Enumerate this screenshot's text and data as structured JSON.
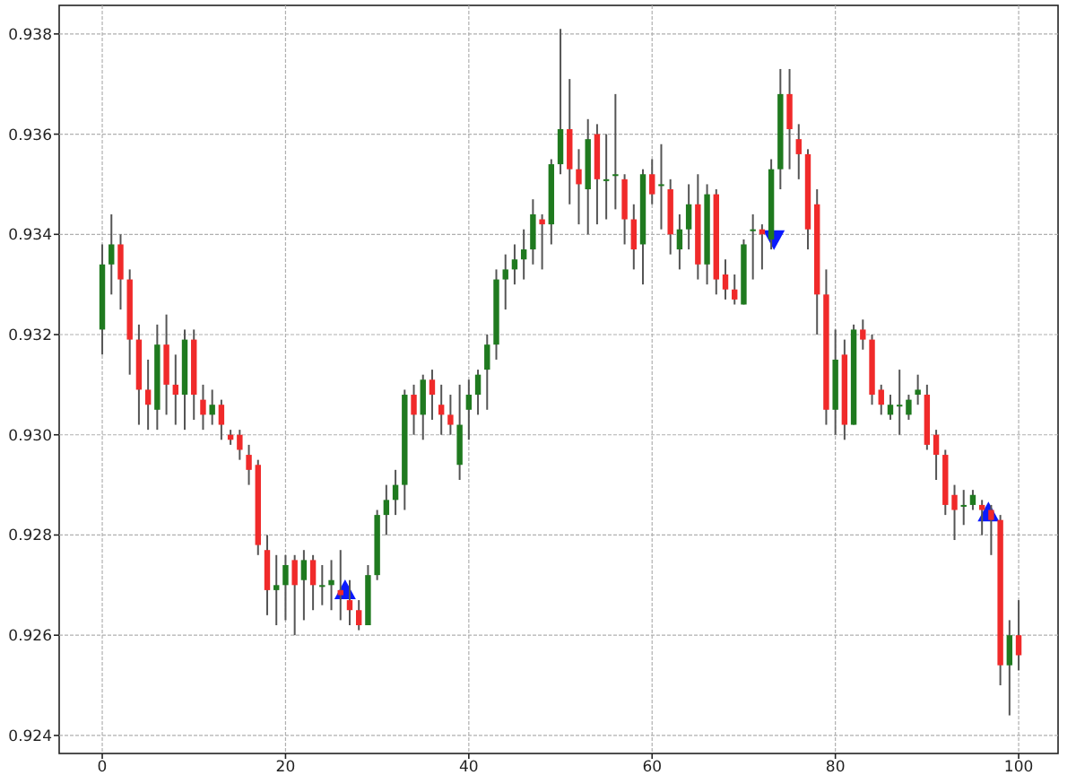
{
  "chart_data": {
    "type": "candlestick",
    "grid": true,
    "x": [
      0,
      1,
      2,
      3,
      4,
      5,
      6,
      7,
      8,
      9,
      10,
      11,
      12,
      13,
      14,
      15,
      16,
      17,
      18,
      19,
      20,
      21,
      22,
      23,
      24,
      25,
      26,
      27,
      28,
      29,
      30,
      31,
      32,
      33,
      34,
      35,
      36,
      37,
      38,
      39,
      40,
      41,
      42,
      43,
      44,
      45,
      46,
      47,
      48,
      49,
      50,
      51,
      52,
      53,
      54,
      55,
      56,
      57,
      58,
      59,
      60,
      61,
      62,
      63,
      64,
      65,
      66,
      67,
      68,
      69,
      70,
      71,
      72,
      73,
      74,
      75,
      76,
      77,
      78,
      79,
      80,
      81,
      82,
      83,
      84,
      85,
      86,
      87,
      88,
      89,
      90,
      91,
      92,
      93,
      94,
      95,
      96,
      97,
      98,
      99,
      100
    ],
    "ohlc": [
      [
        0.9321,
        0.9338,
        0.9316,
        0.9334
      ],
      [
        0.9334,
        0.9344,
        0.9328,
        0.9338
      ],
      [
        0.9338,
        0.934,
        0.9325,
        0.9331
      ],
      [
        0.9331,
        0.9333,
        0.9312,
        0.9319
      ],
      [
        0.9319,
        0.9322,
        0.9302,
        0.9309
      ],
      [
        0.9309,
        0.9315,
        0.9301,
        0.9306
      ],
      [
        0.9305,
        0.9322,
        0.9301,
        0.9318
      ],
      [
        0.9318,
        0.9324,
        0.9304,
        0.931
      ],
      [
        0.931,
        0.9316,
        0.9302,
        0.9308
      ],
      [
        0.9308,
        0.9321,
        0.9301,
        0.9319
      ],
      [
        0.9319,
        0.9321,
        0.9303,
        0.9308
      ],
      [
        0.9307,
        0.931,
        0.9301,
        0.9304
      ],
      [
        0.9304,
        0.9309,
        0.9302,
        0.9306
      ],
      [
        0.9306,
        0.9307,
        0.9299,
        0.9302
      ],
      [
        0.93,
        0.9301,
        0.9298,
        0.9299
      ],
      [
        0.93,
        0.9301,
        0.9295,
        0.9297
      ],
      [
        0.9296,
        0.9298,
        0.929,
        0.9293
      ],
      [
        0.9294,
        0.9295,
        0.9276,
        0.9278
      ],
      [
        0.9277,
        0.928,
        0.9264,
        0.9269
      ],
      [
        0.9269,
        0.9276,
        0.9262,
        0.927
      ],
      [
        0.927,
        0.9276,
        0.9263,
        0.9274
      ],
      [
        0.9275,
        0.9276,
        0.926,
        0.927
      ],
      [
        0.9271,
        0.9277,
        0.9263,
        0.9275
      ],
      [
        0.9275,
        0.9276,
        0.9265,
        0.927
      ],
      [
        0.927,
        0.9274,
        0.9266,
        0.927
      ],
      [
        0.927,
        0.9275,
        0.9265,
        0.9271
      ],
      [
        0.9269,
        0.9277,
        0.9263,
        0.9268
      ],
      [
        0.9267,
        0.9271,
        0.9262,
        0.9265
      ],
      [
        0.9265,
        0.9267,
        0.9261,
        0.9262
      ],
      [
        0.9262,
        0.9274,
        0.9262,
        0.9272
      ],
      [
        0.9272,
        0.9285,
        0.9271,
        0.9284
      ],
      [
        0.9284,
        0.929,
        0.928,
        0.9287
      ],
      [
        0.9287,
        0.9293,
        0.9284,
        0.929
      ],
      [
        0.929,
        0.9309,
        0.9285,
        0.9308
      ],
      [
        0.9308,
        0.931,
        0.93,
        0.9304
      ],
      [
        0.9304,
        0.9312,
        0.9299,
        0.9311
      ],
      [
        0.9311,
        0.9313,
        0.9303,
        0.9308
      ],
      [
        0.9306,
        0.931,
        0.93,
        0.9304
      ],
      [
        0.9304,
        0.9308,
        0.93,
        0.9302
      ],
      [
        0.9294,
        0.931,
        0.9291,
        0.9302
      ],
      [
        0.9305,
        0.9311,
        0.9299,
        0.9308
      ],
      [
        0.9308,
        0.9313,
        0.9304,
        0.9312
      ],
      [
        0.9313,
        0.932,
        0.9305,
        0.9318
      ],
      [
        0.9318,
        0.9333,
        0.9315,
        0.9331
      ],
      [
        0.9331,
        0.9336,
        0.9325,
        0.9333
      ],
      [
        0.9333,
        0.9338,
        0.933,
        0.9335
      ],
      [
        0.9335,
        0.9341,
        0.9331,
        0.9337
      ],
      [
        0.9337,
        0.9347,
        0.9334,
        0.9344
      ],
      [
        0.9343,
        0.9344,
        0.9333,
        0.9342
      ],
      [
        0.9342,
        0.9355,
        0.9338,
        0.9354
      ],
      [
        0.9354,
        0.9381,
        0.9352,
        0.9361
      ],
      [
        0.9361,
        0.9371,
        0.9346,
        0.9353
      ],
      [
        0.9353,
        0.9357,
        0.9342,
        0.935
      ],
      [
        0.9349,
        0.9363,
        0.934,
        0.9359
      ],
      [
        0.936,
        0.9362,
        0.9342,
        0.9351
      ],
      [
        0.9351,
        0.936,
        0.9343,
        0.9351
      ],
      [
        0.9352,
        0.9368,
        0.9345,
        0.9352
      ],
      [
        0.9351,
        0.9352,
        0.9338,
        0.9343
      ],
      [
        0.9343,
        0.9346,
        0.9333,
        0.9337
      ],
      [
        0.9338,
        0.9353,
        0.933,
        0.9352
      ],
      [
        0.9352,
        0.9355,
        0.9346,
        0.9348
      ],
      [
        0.935,
        0.9358,
        0.9341,
        0.935
      ],
      [
        0.9349,
        0.9351,
        0.9336,
        0.934
      ],
      [
        0.9337,
        0.9344,
        0.9333,
        0.9341
      ],
      [
        0.9341,
        0.935,
        0.9337,
        0.9346
      ],
      [
        0.9346,
        0.9352,
        0.9331,
        0.9334
      ],
      [
        0.9334,
        0.935,
        0.933,
        0.9348
      ],
      [
        0.9348,
        0.9349,
        0.9328,
        0.9331
      ],
      [
        0.9332,
        0.9335,
        0.9327,
        0.9329
      ],
      [
        0.9329,
        0.9332,
        0.9326,
        0.9327
      ],
      [
        0.9326,
        0.9339,
        0.9326,
        0.9338
      ],
      [
        0.9341,
        0.9344,
        0.9331,
        0.9341
      ],
      [
        0.9341,
        0.9342,
        0.9333,
        0.934
      ],
      [
        0.9339,
        0.9355,
        0.9337,
        0.9353
      ],
      [
        0.9353,
        0.9373,
        0.9349,
        0.9368
      ],
      [
        0.9368,
        0.9373,
        0.9353,
        0.9361
      ],
      [
        0.9359,
        0.9362,
        0.9351,
        0.9356
      ],
      [
        0.9356,
        0.9357,
        0.9337,
        0.9341
      ],
      [
        0.9346,
        0.9349,
        0.932,
        0.9328
      ],
      [
        0.9328,
        0.9333,
        0.9302,
        0.9305
      ],
      [
        0.9305,
        0.9321,
        0.93,
        0.9315
      ],
      [
        0.9316,
        0.9319,
        0.9299,
        0.9302
      ],
      [
        0.9302,
        0.9322,
        0.9302,
        0.9321
      ],
      [
        0.9321,
        0.9323,
        0.9317,
        0.9319
      ],
      [
        0.9319,
        0.932,
        0.9306,
        0.9308
      ],
      [
        0.9309,
        0.931,
        0.9304,
        0.9306
      ],
      [
        0.9304,
        0.9308,
        0.9303,
        0.9306
      ],
      [
        0.9306,
        0.9313,
        0.93,
        0.9306
      ],
      [
        0.9304,
        0.9308,
        0.9303,
        0.9307
      ],
      [
        0.9308,
        0.9312,
        0.9306,
        0.9309
      ],
      [
        0.9308,
        0.931,
        0.9297,
        0.9298
      ],
      [
        0.93,
        0.9301,
        0.9291,
        0.9296
      ],
      [
        0.9296,
        0.9297,
        0.9284,
        0.9286
      ],
      [
        0.9288,
        0.929,
        0.9279,
        0.9285
      ],
      [
        0.9286,
        0.9289,
        0.9282,
        0.9286
      ],
      [
        0.9286,
        0.9289,
        0.9285,
        0.9288
      ],
      [
        0.9286,
        0.9287,
        0.928,
        0.9285
      ],
      [
        0.9285,
        0.9286,
        0.9276,
        0.9283
      ],
      [
        0.9283,
        0.9284,
        0.925,
        0.9254
      ],
      [
        0.9254,
        0.9263,
        0.9244,
        0.926
      ],
      [
        0.926,
        0.9267,
        0.9253,
        0.9256
      ]
    ],
    "xlim": [
      -4.7,
      104.3
    ],
    "ylim": [
      0.92364,
      0.93857
    ],
    "xticks": [
      0,
      20,
      40,
      60,
      80,
      100
    ],
    "yticks": [
      {
        "value": 0.924,
        "label": "0.924"
      },
      {
        "value": 0.926,
        "label": "0.926"
      },
      {
        "value": 0.928,
        "label": "0.928"
      },
      {
        "value": 0.93,
        "label": "0.930"
      },
      {
        "value": 0.932,
        "label": "0.932"
      },
      {
        "value": 0.934,
        "label": "0.934"
      },
      {
        "value": 0.936,
        "label": "0.936"
      },
      {
        "value": 0.938,
        "label": "0.938"
      }
    ]
  },
  "markers": [
    {
      "kind": "up"
    },
    {
      "kind": "down"
    },
    {
      "kind": "up"
    }
  ]
}
